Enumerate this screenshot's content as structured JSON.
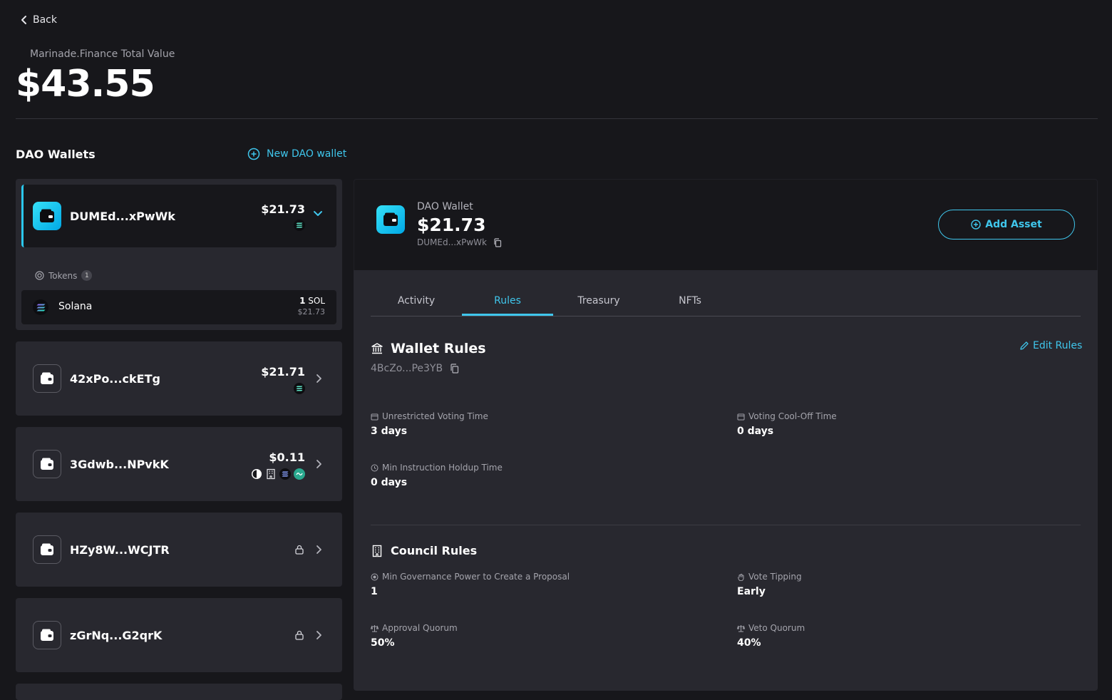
{
  "header": {
    "back_label": "Back",
    "total_label": "Marinade.Finance Total Value",
    "total_value": "$43.55"
  },
  "wallets_section": {
    "title": "DAO Wallets",
    "new_wallet_label": "New DAO wallet"
  },
  "wallets": [
    {
      "name": "DUMEd...xPwWk",
      "value": "$21.73",
      "tokens": [
        "solana-icon"
      ],
      "expanded": true
    },
    {
      "name": "42xPo...ckETg",
      "value": "$21.71",
      "tokens": [
        "solana-icon"
      ]
    },
    {
      "name": "3Gdwb...NPvkK",
      "value": "$0.11",
      "tokens": [
        "half-circle-icon",
        "building-icon",
        "solana-icon",
        "marinade-icon"
      ]
    },
    {
      "name": "HZy8W...WCJTR",
      "locked": true
    },
    {
      "name": "zGrNq...G2qrK",
      "locked": true
    }
  ],
  "active_wallet_tokens": {
    "label": "Tokens",
    "count": "1",
    "items": [
      {
        "name": "Solana",
        "amount": "1",
        "unit": "SOL",
        "value": "$21.73"
      }
    ]
  },
  "detail": {
    "label": "DAO Wallet",
    "value": "$21.73",
    "address": "DUMEd...xPwWk",
    "add_asset_label": "Add Asset",
    "tabs": [
      "Activity",
      "Rules",
      "Treasury",
      "NFTs"
    ],
    "active_tab": "Rules"
  },
  "wallet_rules": {
    "title": "Wallet Rules",
    "address": "4BcZo...Pe3YB",
    "edit_label": "Edit Rules",
    "items": [
      {
        "label": "Unrestricted Voting Time",
        "value": "3 days"
      },
      {
        "label": "Voting Cool-Off Time",
        "value": "0 days"
      },
      {
        "label": "Min Instruction Holdup Time",
        "value": "0 days"
      }
    ]
  },
  "council_rules": {
    "title": "Council Rules",
    "items": [
      {
        "label": "Min Governance Power to Create a Proposal",
        "value": "1"
      },
      {
        "label": "Vote Tipping",
        "value": "Early"
      },
      {
        "label": "Approval Quorum",
        "value": "50%"
      },
      {
        "label": "Veto Quorum",
        "value": "40%"
      }
    ]
  },
  "colors": {
    "accent": "#3fc6ec",
    "background": "#17171b",
    "card": "#28282f"
  }
}
